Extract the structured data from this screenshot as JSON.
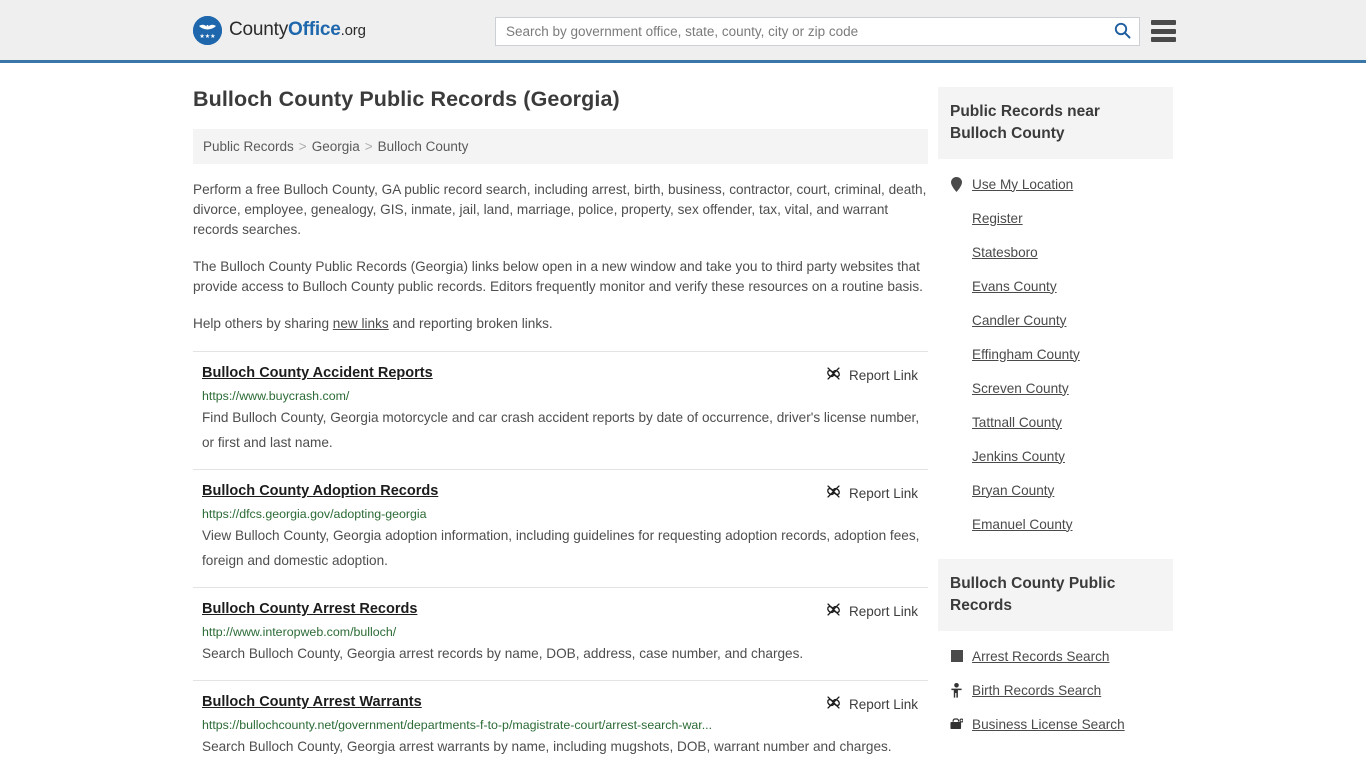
{
  "header": {
    "logo": {
      "part1": "County",
      "part2": "Office",
      "part3": ".org",
      "icon": "eagle-seal-icon"
    },
    "search": {
      "placeholder": "Search by government office, state, county, city or zip code",
      "value": "",
      "icon": "search-icon"
    },
    "menu_icon": "hamburger-menu-icon",
    "accent_color": "#3a76a8"
  },
  "main": {
    "title": "Bulloch County Public Records (Georgia)",
    "breadcrumb": [
      {
        "label": "Public Records"
      },
      {
        "label": "Georgia"
      },
      {
        "label": "Bulloch County"
      }
    ],
    "breadcrumb_separator": ">",
    "intro": {
      "p1": "Perform a free Bulloch County, GA public record search, including arrest, birth, business, contractor, court, criminal, death, divorce, employee, genealogy, GIS, inmate, jail, land, marriage, police, property, sex offender, tax, vital, and warrant records searches.",
      "p2": "The Bulloch County Public Records (Georgia) links below open in a new window and take you to third party websites that provide access to Bulloch County public records. Editors frequently monitor and verify these resources on a routine basis.",
      "p3_before": "Help others by sharing ",
      "p3_link": "new links",
      "p3_after": " and reporting broken links."
    },
    "report_link_label": "Report Link",
    "report_link_icon": "broken-link-icon",
    "records": [
      {
        "title": "Bulloch County Accident Reports",
        "url": "https://www.buycrash.com/",
        "description": "Find Bulloch County, Georgia motorcycle and car crash accident reports by date of occurrence, driver's license number, or first and last name."
      },
      {
        "title": "Bulloch County Adoption Records",
        "url": "https://dfcs.georgia.gov/adopting-georgia",
        "description": "View Bulloch County, Georgia adoption information, including guidelines for requesting adoption records, adoption fees, foreign and domestic adoption."
      },
      {
        "title": "Bulloch County Arrest Records",
        "url": "http://www.interopweb.com/bulloch/",
        "description": "Search Bulloch County, Georgia arrest records by name, DOB, address, case number, and charges."
      },
      {
        "title": "Bulloch County Arrest Warrants",
        "url": "https://bullochcounty.net/government/departments-f-to-p/magistrate-court/arrest-search-war...",
        "description": "Search Bulloch County, Georgia arrest warrants by name, including mugshots, DOB, warrant number and charges."
      }
    ]
  },
  "sidebar": {
    "nearby": {
      "heading": "Public Records near Bulloch County",
      "items": [
        {
          "label": "Use My Location",
          "icon": "map-pin-icon"
        },
        {
          "label": "Register",
          "icon": ""
        },
        {
          "label": "Statesboro",
          "icon": ""
        },
        {
          "label": "Evans County",
          "icon": ""
        },
        {
          "label": "Candler County",
          "icon": ""
        },
        {
          "label": "Effingham County",
          "icon": ""
        },
        {
          "label": "Screven County",
          "icon": ""
        },
        {
          "label": "Tattnall County",
          "icon": ""
        },
        {
          "label": "Jenkins County",
          "icon": ""
        },
        {
          "label": "Bryan County",
          "icon": ""
        },
        {
          "label": "Emanuel County",
          "icon": ""
        }
      ]
    },
    "records": {
      "heading": "Bulloch County Public Records",
      "items": [
        {
          "label": "Arrest Records Search",
          "icon": "handcuffs-icon"
        },
        {
          "label": "Birth Records Search",
          "icon": "baby-icon"
        },
        {
          "label": "Business License Search",
          "icon": "briefcase-icon"
        }
      ]
    }
  }
}
